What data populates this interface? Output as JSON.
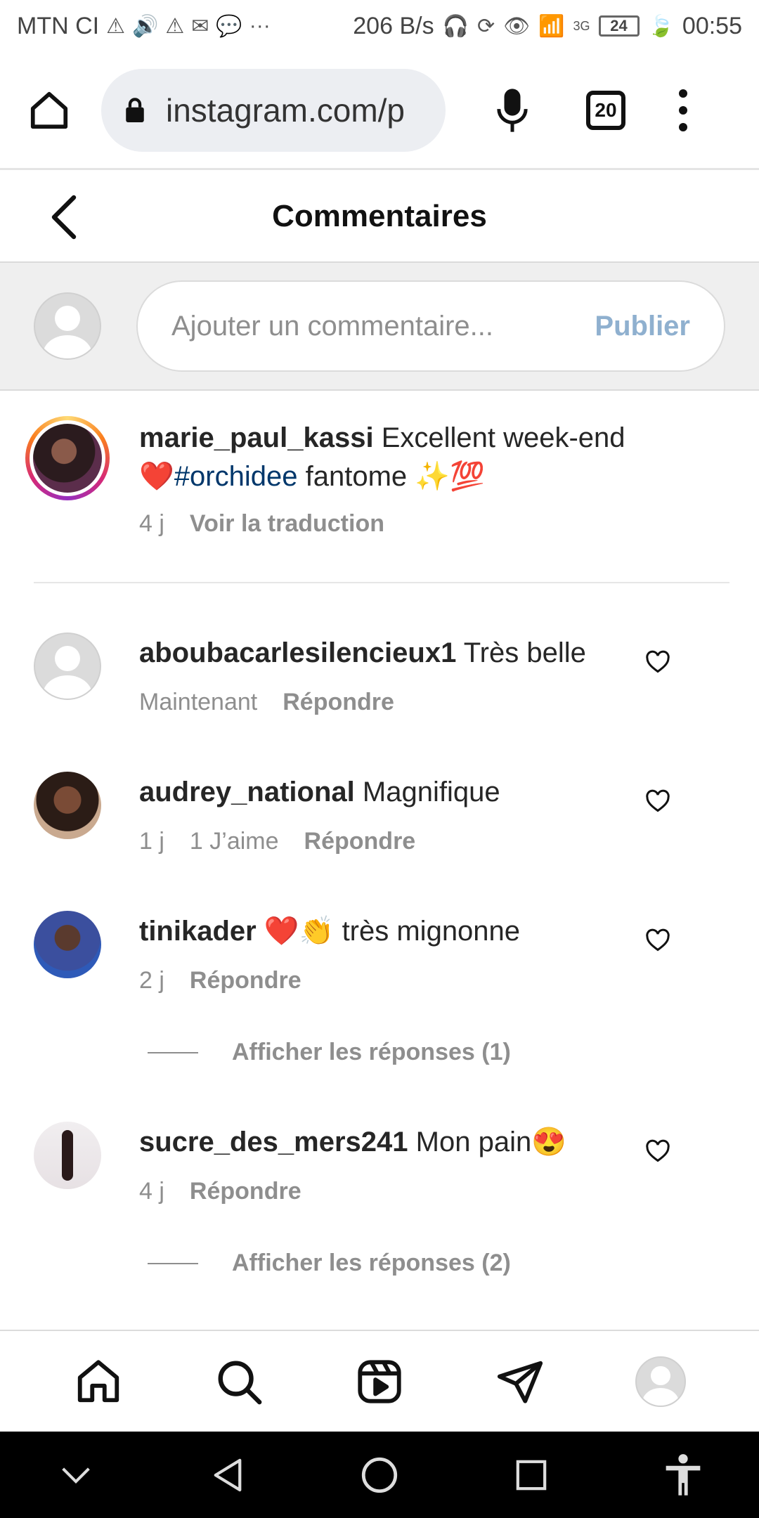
{
  "status_bar": {
    "carrier": "MTN CI",
    "speed": "206 B/s",
    "network": "3G",
    "battery": "24",
    "time": "00:55",
    "icons": [
      "warning-icon",
      "volume-icon",
      "warning-icon",
      "gmail-icon",
      "chat-icon",
      "more-icon",
      "headphones-icon",
      "sync-icon",
      "eye-icon",
      "wifi-icon",
      "signal-icon",
      "leaf-icon"
    ]
  },
  "browser": {
    "url": "instagram.com/p",
    "tab_count": "20"
  },
  "header": {
    "title": "Commentaires"
  },
  "composer": {
    "placeholder": "Ajouter un commentaire...",
    "publish_label": "Publier",
    "publish_color": "#8fb0cf"
  },
  "caption": {
    "username": "marie_paul_kassi",
    "text_before": "Excellent week-end",
    "emoji_heart": "❤️",
    "hashtag": "#orchidee",
    "text_after": "fantome",
    "emojis_end": "✨💯",
    "time": "4 j",
    "translate_label": "Voir la traduction"
  },
  "comments": [
    {
      "username": "aboubacarlesilencieux1",
      "text": "Très belle",
      "time": "Maintenant",
      "likes": "",
      "reply_label": "Répondre"
    },
    {
      "username": "audrey_national",
      "text": "Magnifique",
      "time": "1 j",
      "likes": "1 J’aime",
      "reply_label": "Répondre"
    },
    {
      "username": "tinikader",
      "text": "❤️👏 très mignonne",
      "time": "2 j",
      "likes": "",
      "reply_label": "Répondre",
      "replies_label": "Afficher les réponses (1)"
    },
    {
      "username": "sucre_des_mers241",
      "text": "Mon pain😍",
      "time": "4 j",
      "likes": "",
      "reply_label": "Répondre",
      "replies_label": "Afficher les réponses (2)"
    }
  ],
  "colors": {
    "text": "#262626",
    "secondary": "#8e8e8e",
    "hashtag": "#00376b"
  }
}
